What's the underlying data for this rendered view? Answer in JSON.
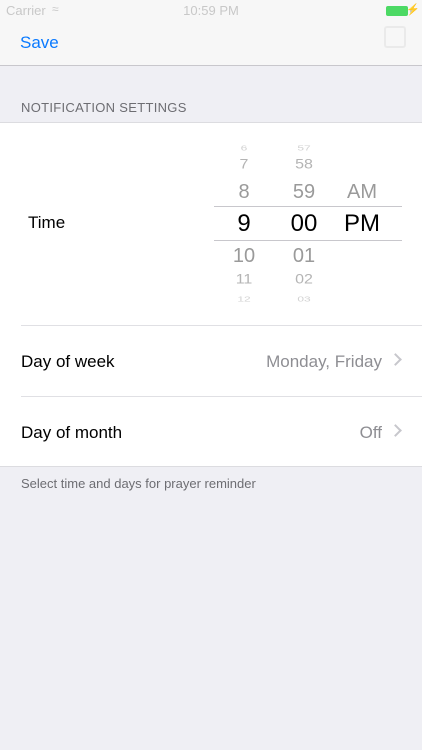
{
  "status_bar": {
    "carrier": "Carrier",
    "time": "10:59 PM"
  },
  "nav": {
    "save_label": "Save"
  },
  "section": {
    "header": "NOTIFICATION SETTINGS",
    "footer": "Select time and days for prayer reminder"
  },
  "time_row": {
    "label": "Time",
    "picker": {
      "hours": [
        "6",
        "7",
        "8",
        "9",
        "10",
        "11",
        "12"
      ],
      "minutes": [
        "57",
        "58",
        "59",
        "00",
        "01",
        "02",
        "03"
      ],
      "ampm": [
        "AM",
        "PM"
      ],
      "selected": {
        "hour": "9",
        "minute": "00",
        "period": "PM"
      }
    }
  },
  "day_of_week": {
    "label": "Day of week",
    "value": "Monday, Friday"
  },
  "day_of_month": {
    "label": "Day of month",
    "value": "Off"
  },
  "colors": {
    "accent": "#0a7aff",
    "background": "#efeff4",
    "battery": "#4cd964"
  }
}
